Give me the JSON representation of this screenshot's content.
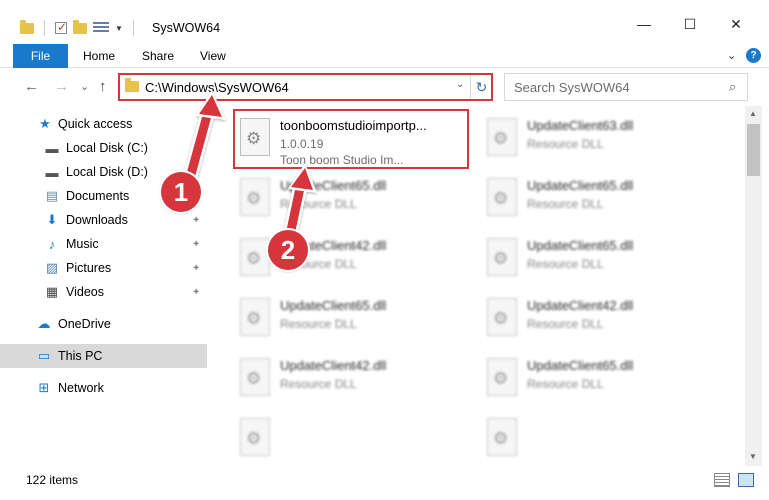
{
  "window": {
    "title": "SysWOW64",
    "minimize": "—",
    "maximize": "☐",
    "close": "✕"
  },
  "ribbon": {
    "tabs": [
      "File",
      "Home",
      "Share",
      "View"
    ],
    "expand": "⌄",
    "help": "?"
  },
  "nav": {
    "back": "←",
    "forward": "→",
    "recent": "⌄",
    "up": "↑",
    "address": "C:\\Windows\\SysWOW64",
    "address_dropdown": "⌄",
    "refresh": "↻",
    "search_placeholder": "Search SysWOW64",
    "search_icon": "⌕"
  },
  "sidebar": {
    "items": [
      {
        "label": "Quick access",
        "icon": "star-icon",
        "glyph": "★",
        "color": "#1979ca"
      },
      {
        "label": "Local Disk (C:)",
        "icon": "drive-icon",
        "glyph": "▬",
        "color": "#555555"
      },
      {
        "label": "Local Disk (D:)",
        "icon": "drive-icon",
        "glyph": "▬",
        "color": "#555555"
      },
      {
        "label": "Documents",
        "icon": "documents-icon",
        "glyph": "▤",
        "color": "#6b87b3"
      },
      {
        "label": "Downloads",
        "icon": "download-icon",
        "glyph": "⬇",
        "color": "#1979ca"
      },
      {
        "label": "Music",
        "icon": "music-icon",
        "glyph": "♪",
        "color": "#1979ca"
      },
      {
        "label": "Pictures",
        "icon": "pictures-icon",
        "glyph": "▨",
        "color": "#4a7fb5"
      },
      {
        "label": "Videos",
        "icon": "videos-icon",
        "glyph": "▦",
        "color": "#444444"
      },
      {
        "label": "OneDrive",
        "icon": "cloud-icon",
        "glyph": "☁",
        "color": "#1979ca"
      },
      {
        "label": "This PC",
        "icon": "computer-icon",
        "glyph": "▭",
        "color": "#1979ca"
      },
      {
        "label": "Network",
        "icon": "network-icon",
        "glyph": "⊞",
        "color": "#1979ca"
      }
    ],
    "pin_glyph": "📌"
  },
  "files": {
    "focused": {
      "name": "toonboomstudioimportp...",
      "line2": "1.0.0.19",
      "line3": "Toon boom Studio Im..."
    },
    "tiles": [
      {
        "name": "UpdateClient63.dll",
        "desc": "Resource DLL"
      },
      {
        "name": "UpdateClient65.dll",
        "desc": "Resource DLL"
      },
      {
        "name": "UpdateClient65.dll",
        "desc": "Resource DLL"
      },
      {
        "name": "UpdateClient42.dll",
        "desc": "Resource DLL"
      },
      {
        "name": "UpdateClient65.dll",
        "desc": "Resource DLL"
      },
      {
        "name": "UpdateClient65.dll",
        "desc": "Resource DLL"
      },
      {
        "name": "UpdateClient42.dll",
        "desc": "Resource DLL"
      },
      {
        "name": "UpdateClient42.dll",
        "desc": "Resource DLL"
      },
      {
        "name": "UpdateClient65.dll",
        "desc": "Resource DLL"
      }
    ]
  },
  "scrollbar": {
    "up": "▲",
    "down": "▼"
  },
  "status": {
    "items": "122 items"
  },
  "annotations": {
    "step1": "1",
    "step2": "2",
    "color": "#d6353c"
  }
}
